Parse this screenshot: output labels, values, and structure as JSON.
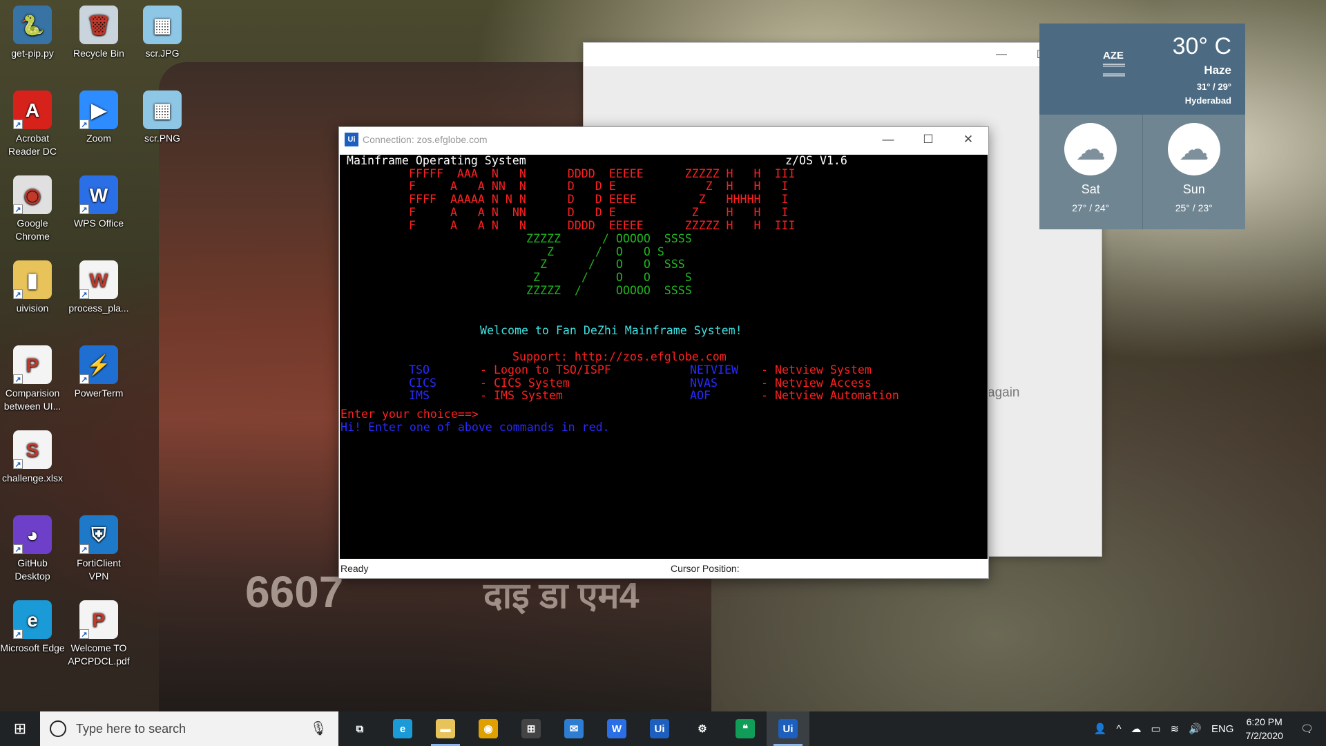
{
  "desktop": {
    "icons": [
      {
        "label": "get-pip.py",
        "icon": "python-file-icon"
      },
      {
        "label": "Recycle Bin",
        "icon": "recycle-bin-icon"
      },
      {
        "label": "scr.JPG",
        "icon": "image-file-icon"
      },
      {
        "label": "Acrobat Reader DC",
        "icon": "acrobat-icon"
      },
      {
        "label": "Zoom",
        "icon": "zoom-icon"
      },
      {
        "label": "scr.PNG",
        "icon": "image-file-icon"
      },
      {
        "label": "Google Chrome",
        "icon": "chrome-icon"
      },
      {
        "label": "WPS Office",
        "icon": "wps-office-icon"
      },
      {
        "label": "uivision",
        "icon": "folder-icon"
      },
      {
        "label": "process_pla...",
        "icon": "word-document-icon"
      },
      {
        "label": "Comparision between UI...",
        "icon": "presentation-file-icon"
      },
      {
        "label": "PowerTerm",
        "icon": "powerterm-icon"
      },
      {
        "label": "challenge.xlsx",
        "icon": "spreadsheet-file-icon"
      },
      {
        "label": "GitHub Desktop",
        "icon": "github-desktop-icon"
      },
      {
        "label": "FortiClient VPN",
        "icon": "forticlient-icon"
      },
      {
        "label": "Microsoft Edge",
        "icon": "edge-icon"
      },
      {
        "label": "Welcome TO APCPDCL.pdf",
        "icon": "pdf-file-icon"
      }
    ],
    "wallpaper_text": {
      "number": "6607",
      "hindi": "दाइ डा एम4"
    }
  },
  "background_window": {
    "partial_text": "again"
  },
  "weather": {
    "partial_label": "AZE",
    "temperature": "30° C",
    "condition": "Haze",
    "hi_lo": "31° / 29°",
    "city": "Hyderabad",
    "forecast": [
      {
        "day": "Sat",
        "range": "27° / 24°",
        "icon": "cloud-icon"
      },
      {
        "day": "Sun",
        "range": "25° / 23°",
        "icon": "cloud-icon"
      }
    ]
  },
  "terminal_window": {
    "title": "Connection: zos.efglobe.com",
    "app_icon_label": "Ui",
    "screen": {
      "header_left": "Mainframe Operating System",
      "header_right": "z/OS V1.6",
      "banner_red": [
        "FFFFF  AAA  N   N      DDDD  EEEEE      ZZZZZ H   H  III",
        "F     A   A NN  N      D   D E             Z  H   H   I",
        "FFFF  AAAAA N N N      D   D EEEE         Z   HHHHH   I",
        "F     A   A N  NN      D   D E           Z    H   H   I",
        "F     A   A N   N      DDDD  EEEEE      ZZZZZ H   H  III"
      ],
      "banner_green": [
        "ZZZZZ      / OOOOO  SSSS",
        "   Z      /  O   O S",
        "  Z      /   O   O  SSS",
        " Z      /    O   O     S",
        "ZZZZZ  /     OOOOO  SSSS"
      ],
      "welcome": "Welcome to Fan DeZhi Mainframe System!",
      "support": "Support: http://zos.efglobe.com",
      "menu_left": [
        {
          "cmd": "TSO",
          "desc": "- Logon to TSO/ISPF"
        },
        {
          "cmd": "CICS",
          "desc": "- CICS System"
        },
        {
          "cmd": "IMS",
          "desc": "- IMS System"
        }
      ],
      "menu_right": [
        {
          "cmd": "NETVIEW",
          "desc": "- Netview System"
        },
        {
          "cmd": "NVAS",
          "desc": "- Netview Access"
        },
        {
          "cmd": "AOF",
          "desc": "- Netview Automation"
        }
      ],
      "prompt": "Enter your choice==>",
      "hint": "Hi! Enter one of above commands in red."
    },
    "status": {
      "left": "Ready",
      "cursor_label": "Cursor Position:"
    }
  },
  "taskbar": {
    "search_placeholder": "Type here to search",
    "pinned": [
      {
        "name": "task-view-icon",
        "glyph": "⧉",
        "running": false
      },
      {
        "name": "edge-icon",
        "glyph": "e",
        "running": false
      },
      {
        "name": "file-explorer-icon",
        "glyph": "▬",
        "running": true
      },
      {
        "name": "chrome-icon",
        "glyph": "◉",
        "running": false
      },
      {
        "name": "store-icon",
        "glyph": "⊞",
        "running": false
      },
      {
        "name": "mail-icon",
        "glyph": "✉",
        "running": false
      },
      {
        "name": "wps-office-icon",
        "glyph": "W",
        "running": false
      },
      {
        "name": "uipath-studio-icon",
        "glyph": "Ui",
        "running": false
      },
      {
        "name": "robot-icon",
        "glyph": "⚙",
        "running": false
      },
      {
        "name": "hangouts-icon",
        "glyph": "❝",
        "running": false
      },
      {
        "name": "uipath-robot-icon",
        "glyph": "Ui",
        "running": true
      }
    ],
    "tray": {
      "language": "ENG",
      "time": "6:20 PM",
      "date": "7/2/2020"
    }
  },
  "colors": {
    "terminal_red": "#ff2020",
    "terminal_green": "#1fb51f",
    "terminal_cyan": "#3fe0e0",
    "terminal_blue": "#2a2aff",
    "weather_top": "#4c6b82",
    "taskbar": "#1f2326"
  }
}
